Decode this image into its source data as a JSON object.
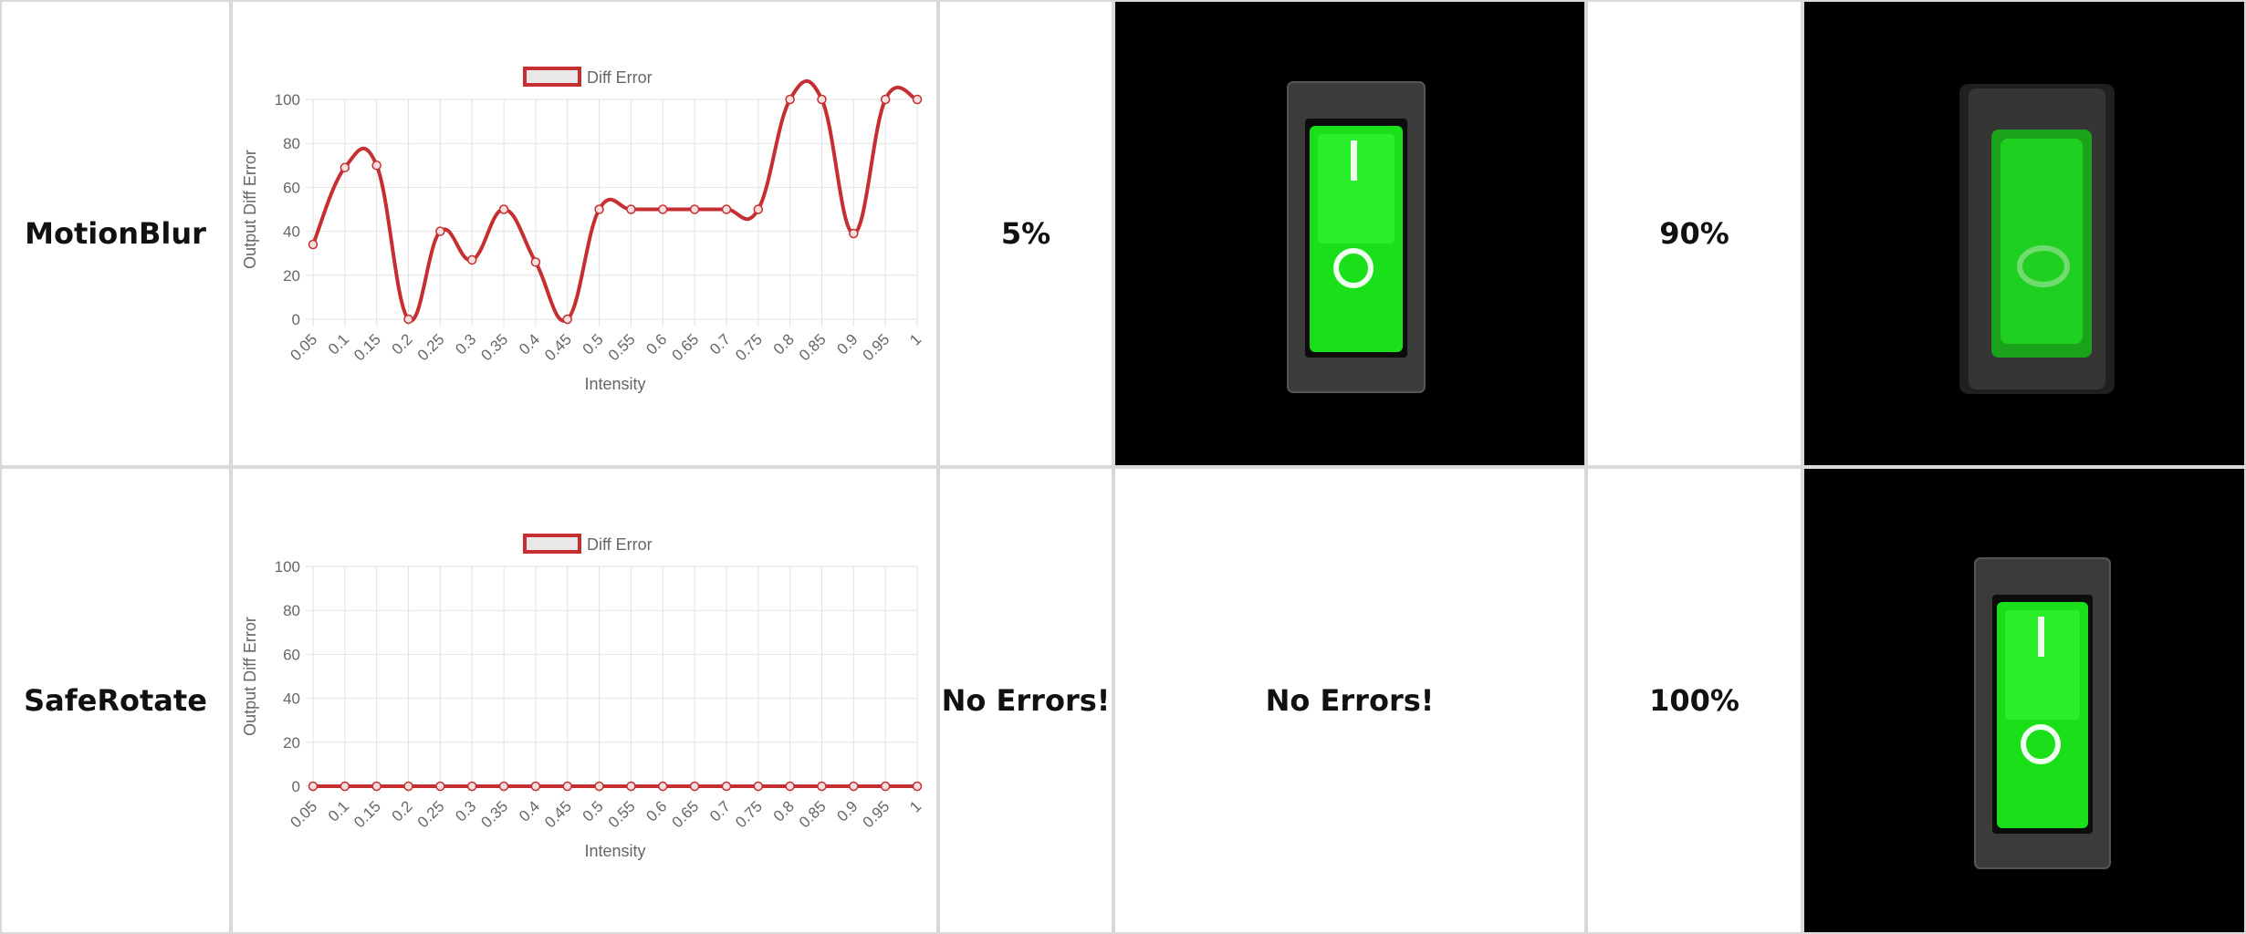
{
  "rows": [
    {
      "transform": "MotionBlur",
      "error_a": "5%",
      "error_b": "90%",
      "chart_data": {
        "type": "line",
        "legend": "Diff Error",
        "xlabel": "Intensity",
        "ylabel": "Output Diff Error",
        "categories": [
          "0.05",
          "0.1",
          "0.15",
          "0.2",
          "0.25",
          "0.3",
          "0.35",
          "0.4",
          "0.45",
          "0.5",
          "0.55",
          "0.6",
          "0.65",
          "0.7",
          "0.75",
          "0.8",
          "0.85",
          "0.9",
          "0.95",
          "1"
        ],
        "series": [
          {
            "name": "Diff Error",
            "values": [
              34,
              69,
              70,
              0,
              40,
              27,
              50,
              26,
              0,
              50,
              50,
              50,
              50,
              50,
              50,
              100,
              100,
              39,
              100,
              100
            ]
          }
        ],
        "ylim": [
          0,
          100
        ],
        "yticks": [
          0,
          20,
          40,
          60,
          80,
          100
        ],
        "grid": true,
        "legend_position": "top-center",
        "color": "#c62f31"
      }
    },
    {
      "transform": "SafeRotate",
      "error_a": "No Errors!",
      "error_b": "No Errors!",
      "error_c": "100%",
      "chart_data": {
        "type": "line",
        "legend": "Diff Error",
        "xlabel": "Intensity",
        "ylabel": "Output Diff Error",
        "categories": [
          "0.05",
          "0.1",
          "0.15",
          "0.2",
          "0.25",
          "0.3",
          "0.35",
          "0.4",
          "0.45",
          "0.5",
          "0.55",
          "0.6",
          "0.65",
          "0.7",
          "0.75",
          "0.8",
          "0.85",
          "0.9",
          "0.95",
          "1"
        ],
        "series": [
          {
            "name": "Diff Error",
            "values": [
              0,
              0,
              0,
              0,
              0,
              0,
              0,
              0,
              0,
              0,
              0,
              0,
              0,
              0,
              0,
              0,
              0,
              0,
              0,
              0
            ]
          }
        ],
        "ylim": [
          0,
          100
        ],
        "yticks": [
          0,
          20,
          40,
          60,
          80,
          100
        ],
        "grid": true,
        "legend_position": "top-center",
        "color": "#c62f31"
      }
    }
  ],
  "images": {
    "switch_original": "green-rocker-switch",
    "switch_blurred": "green-rocker-switch-motion-blurred",
    "switch_rotated": "green-rocker-switch-rotated"
  }
}
